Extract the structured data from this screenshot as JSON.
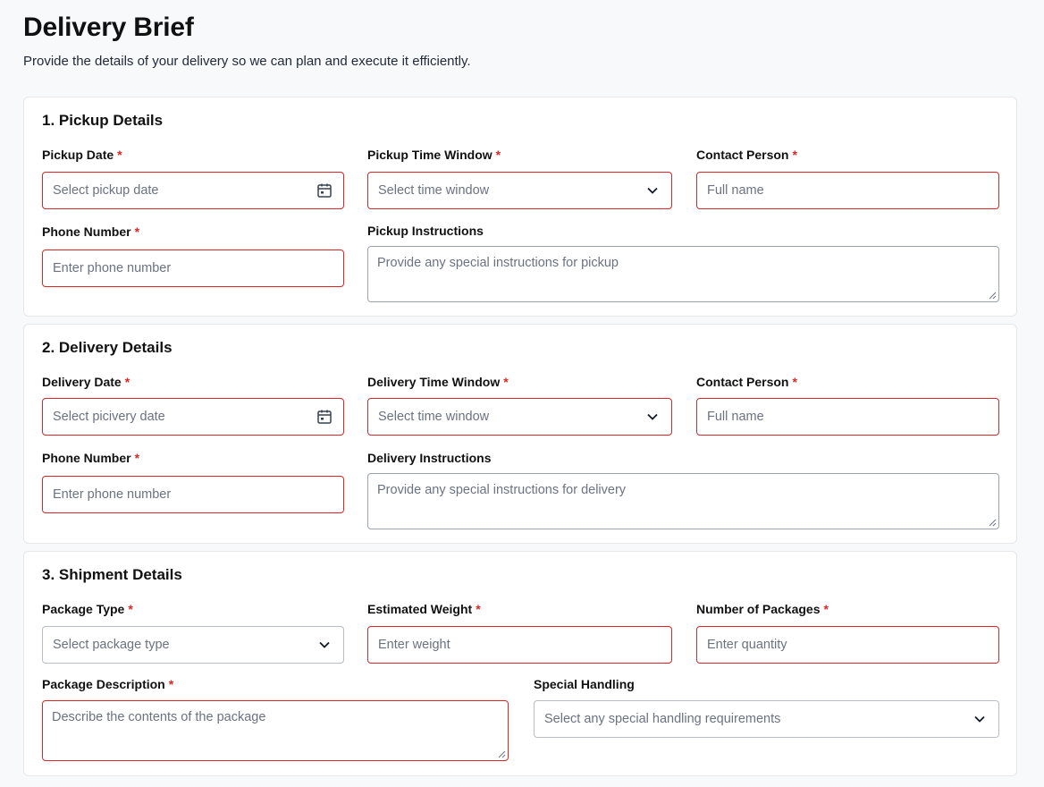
{
  "header": {
    "title": "Delivery Brief",
    "subtitle": "Provide the details of your delivery so we can plan and execute it efficiently."
  },
  "required_marker": "*",
  "icons": {
    "date": "calendar-icon",
    "select": "chevron-down-icon",
    "textarea": "resize-handle-icon"
  },
  "colors": {
    "required_border": "#dc2626",
    "required_asterisk": "#dc2626",
    "neutral_border": "#b8bcc4"
  },
  "pickup": {
    "title": "1. Pickup Details",
    "date": {
      "label": "Pickup Date",
      "placeholder": "Select pickup date"
    },
    "time_window": {
      "label": "Pickup Time Window",
      "placeholder": "Select time window"
    },
    "contact": {
      "label": "Contact Person",
      "placeholder": "Full name"
    },
    "phone": {
      "label": "Phone Number",
      "placeholder": "Enter phone number"
    },
    "instructions": {
      "label": "Pickup Instructions",
      "placeholder": "Provide any special instructions for pickup"
    }
  },
  "delivery": {
    "title": "2. Delivery Details",
    "date": {
      "label": "Delivery Date",
      "placeholder": "Select picivery date"
    },
    "time_window": {
      "label": "Delivery Time Window",
      "placeholder": "Select time window"
    },
    "contact": {
      "label": "Contact Person",
      "placeholder": "Full name"
    },
    "phone": {
      "label": "Phone Number",
      "placeholder": "Enter phone number"
    },
    "instructions": {
      "label": "Delivery Instructions",
      "placeholder": "Provide any special instructions for delivery"
    }
  },
  "shipment": {
    "title": "3. Shipment Details",
    "package_type": {
      "label": "Package Type",
      "placeholder": "Select package type"
    },
    "weight": {
      "label": "Estimated Weight",
      "placeholder": "Enter weight"
    },
    "quantity": {
      "label": "Number of Packages",
      "placeholder": "Enter quantity"
    },
    "description": {
      "label": "Package Description",
      "placeholder": "Describe the contents of the package"
    },
    "special_handling": {
      "label": "Special Handling",
      "placeholder": "Select any special handling requirements"
    }
  }
}
